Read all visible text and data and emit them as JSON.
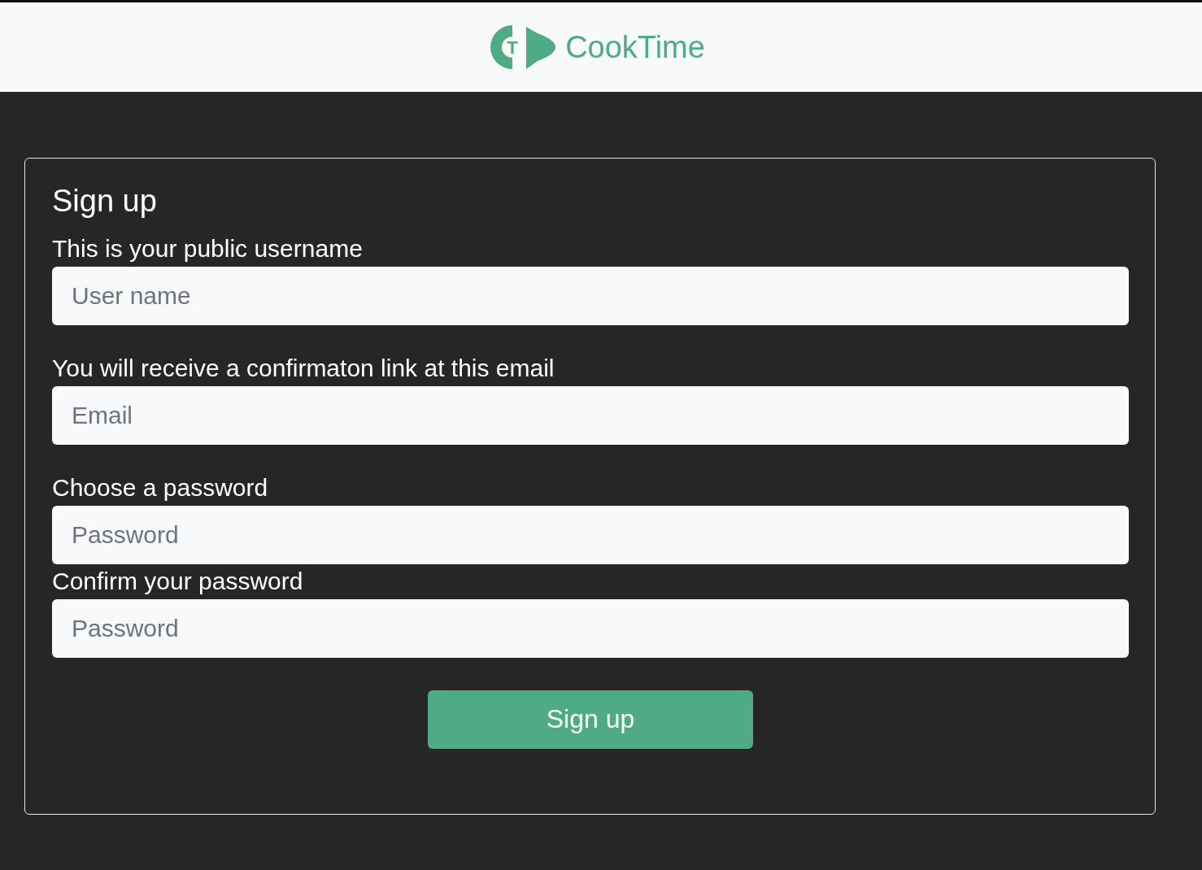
{
  "header": {
    "logo_letter": "T",
    "brand": "CookTime"
  },
  "form": {
    "title": "Sign up",
    "fields": [
      {
        "label": "This is your public username",
        "placeholder": "User name"
      },
      {
        "label": "You will receive a confirmaton link at this email",
        "placeholder": "Email"
      },
      {
        "label": "Choose a password",
        "placeholder": "Password"
      },
      {
        "label": "Confirm your password",
        "placeholder": "Password"
      }
    ],
    "submit": "Sign up"
  }
}
